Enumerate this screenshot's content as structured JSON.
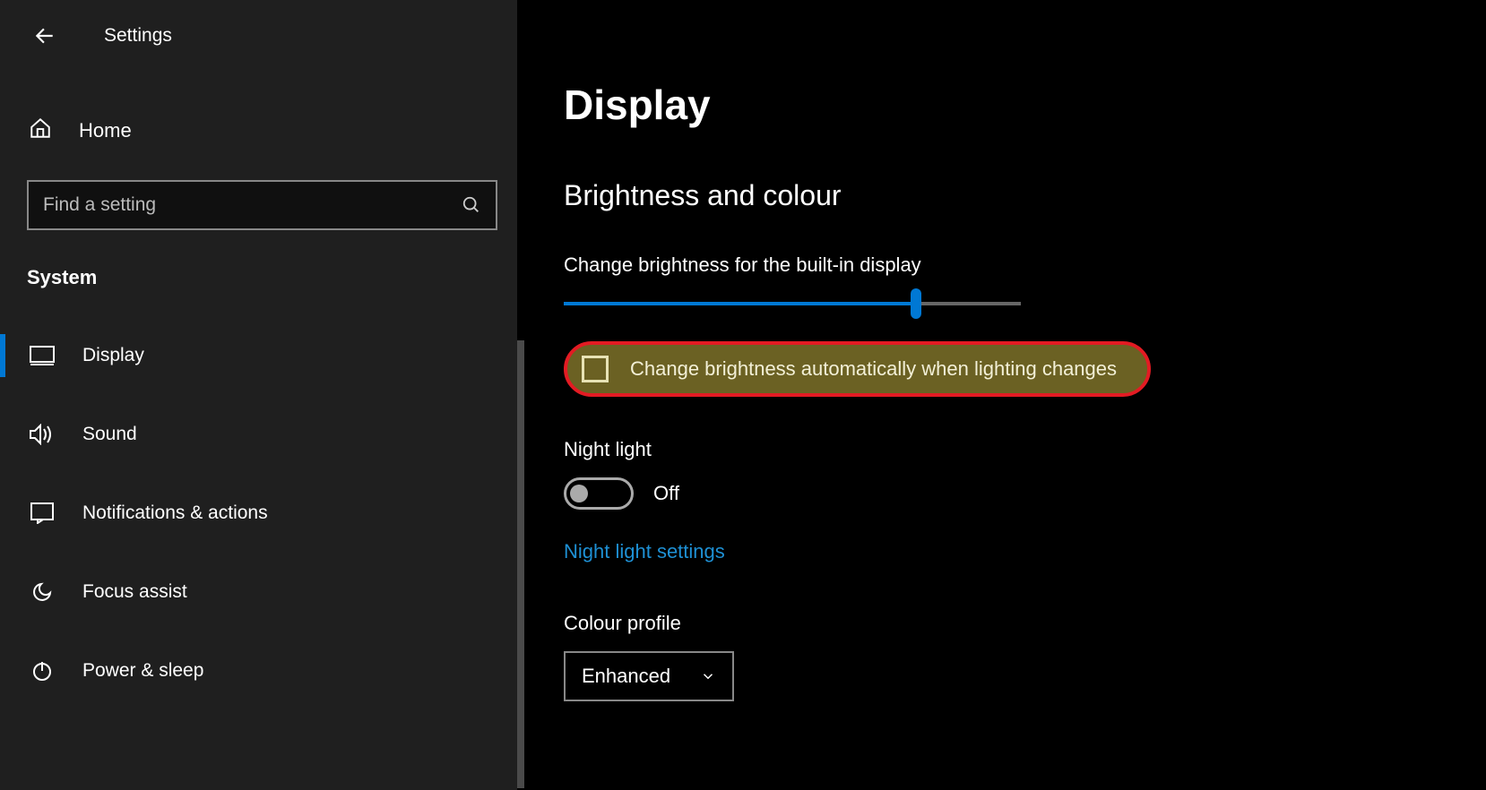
{
  "header": {
    "title": "Settings"
  },
  "sidebar": {
    "home_label": "Home",
    "search_placeholder": "Find a setting",
    "category": "System",
    "items": [
      {
        "label": "Display"
      },
      {
        "label": "Sound"
      },
      {
        "label": "Notifications & actions"
      },
      {
        "label": "Focus assist"
      },
      {
        "label": "Power & sleep"
      }
    ]
  },
  "main": {
    "page_title": "Display",
    "section_title": "Brightness and colour",
    "brightness_label": "Change brightness for the built-in display",
    "brightness_percent": 77,
    "auto_brightness_label": "Change brightness automatically when lighting changes",
    "night_light_heading": "Night light",
    "night_light_state": "Off",
    "night_light_link": "Night light settings",
    "colour_profile_label": "Colour profile",
    "colour_profile_value": "Enhanced"
  }
}
